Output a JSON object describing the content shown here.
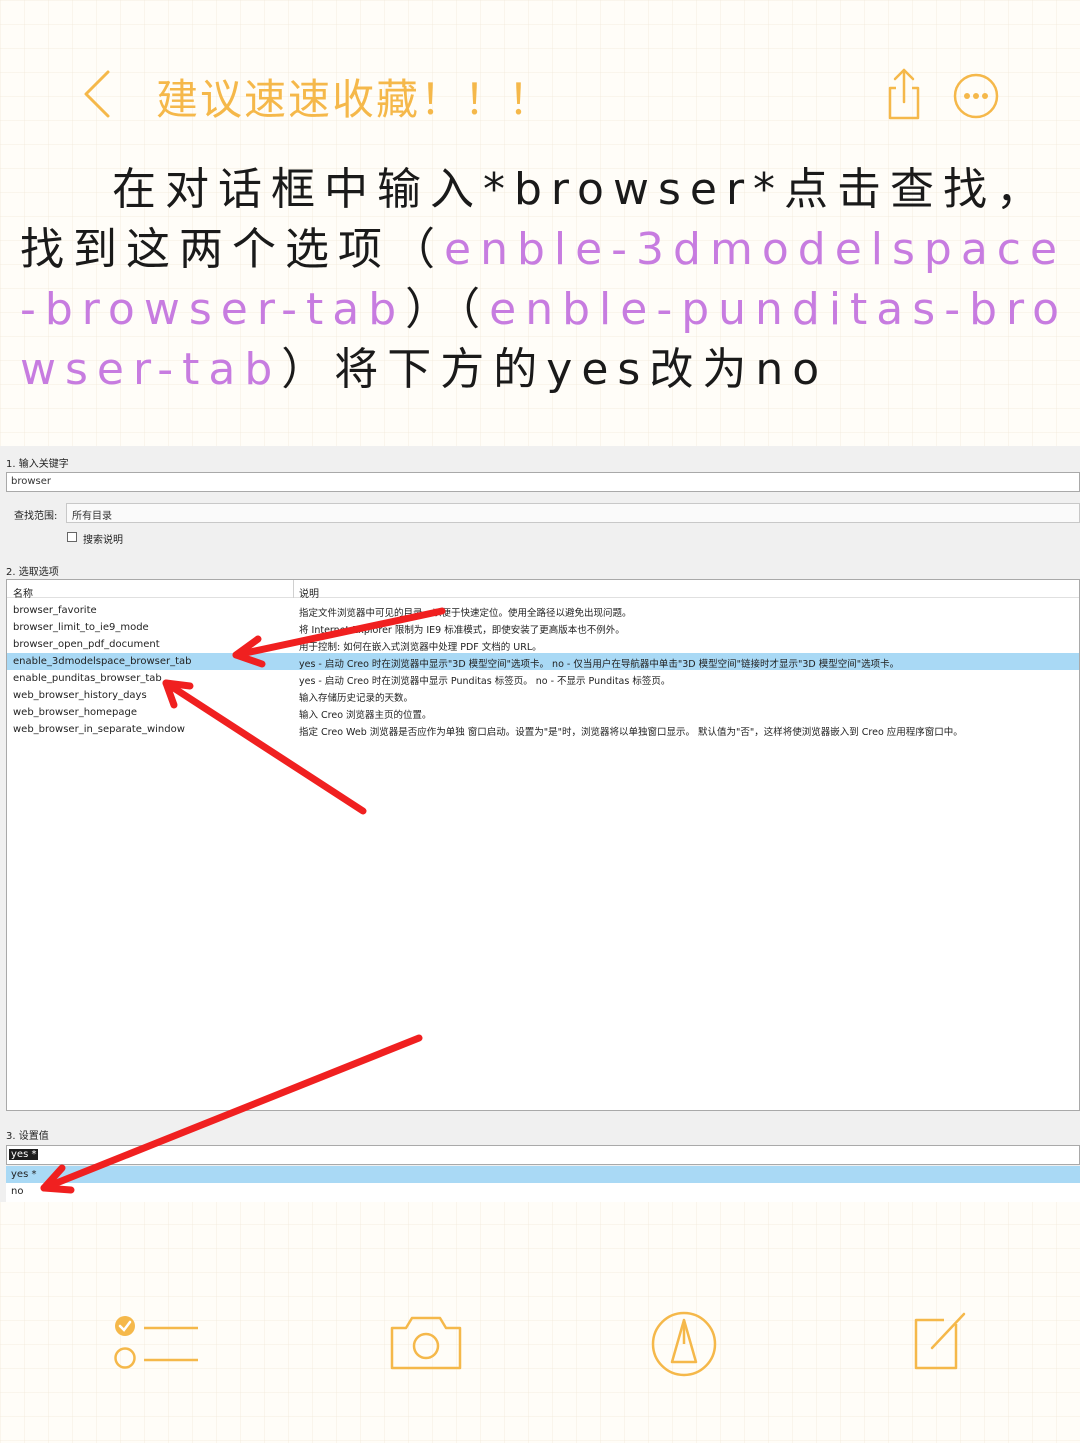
{
  "nav": {
    "title": "建议速速收藏！！！",
    "back_icon": "chevron-left-icon",
    "share_icon": "share-icon",
    "more_icon": "more-options-icon",
    "accent_color": "#f5b84a"
  },
  "note": {
    "parts": [
      {
        "text": "在对话框中输入*browser*点击查找，找到这两个选项（",
        "highlight": false
      },
      {
        "text": "enble-3dmodelspace-browser-tab",
        "highlight": true
      },
      {
        "text": "）（",
        "highlight": false
      },
      {
        "text": "enble-punditas-browser-tab",
        "highlight": true
      },
      {
        "text": "）将下方的yes改为no",
        "highlight": false
      }
    ],
    "highlight_color": "#c77ce0"
  },
  "screenshot": {
    "section1_label": "1. 输入关键字",
    "keyword_value": "browser",
    "scope_label": "查找范围:",
    "scope_value": "所有目录",
    "search_desc_label": "搜索说明",
    "search_desc_checked": false,
    "section2_label": "2. 选取选项",
    "table": {
      "headers": [
        "名称",
        "说明"
      ],
      "rows": [
        {
          "name": "browser_favorite",
          "desc": "指定文件浏览器中可见的目录，以便于快速定位。使用全路径以避免出现问题。",
          "selected": false
        },
        {
          "name": "browser_limit_to_ie9_mode",
          "desc": "将 Internet Explorer 限制为 IE9 标准模式，即使安装了更高版本也不例外。",
          "selected": false
        },
        {
          "name": "browser_open_pdf_document",
          "desc": "用于控制: 如何在嵌入式浏览器中处理 PDF 文档的 URL。",
          "selected": false
        },
        {
          "name": "enable_3dmodelspace_browser_tab",
          "desc": "yes - 启动 Creo 时在浏览器中显示\"3D 模型空间\"选项卡。 no - 仅当用户在导航器中单击\"3D 模型空间\"链接时才显示\"3D 模型空间\"选项卡。",
          "selected": true
        },
        {
          "name": "enable_punditas_browser_tab",
          "desc": "yes - 启动 Creo 时在浏览器中显示 Punditas 标签页。 no - 不显示 Punditas 标签页。",
          "selected": false
        },
        {
          "name": "web_browser_history_days",
          "desc": "输入存储历史记录的天数。",
          "selected": false
        },
        {
          "name": "web_browser_homepage",
          "desc": "输入 Creo 浏览器主页的位置。",
          "selected": false
        },
        {
          "name": "web_browser_in_separate_window",
          "desc": "指定 Creo Web 浏览器是否应作为单独 窗口启动。设置为\"是\"时，浏览器将以单独窗口显示。 默认值为\"否\"，这样将使浏览器嵌入到 Creo 应用程序窗口中。",
          "selected": false
        }
      ]
    },
    "section3_label": "3. 设置值",
    "value_input": "yes *",
    "value_options": [
      {
        "label": "yes *",
        "selected": true
      },
      {
        "label": "no",
        "selected": false
      }
    ],
    "selection_color": "#a9d9f5",
    "arrow_color": "#f02020"
  },
  "toolbar": {
    "items": [
      "checklist-icon",
      "camera-icon",
      "markup-pen-icon",
      "compose-icon"
    ]
  }
}
